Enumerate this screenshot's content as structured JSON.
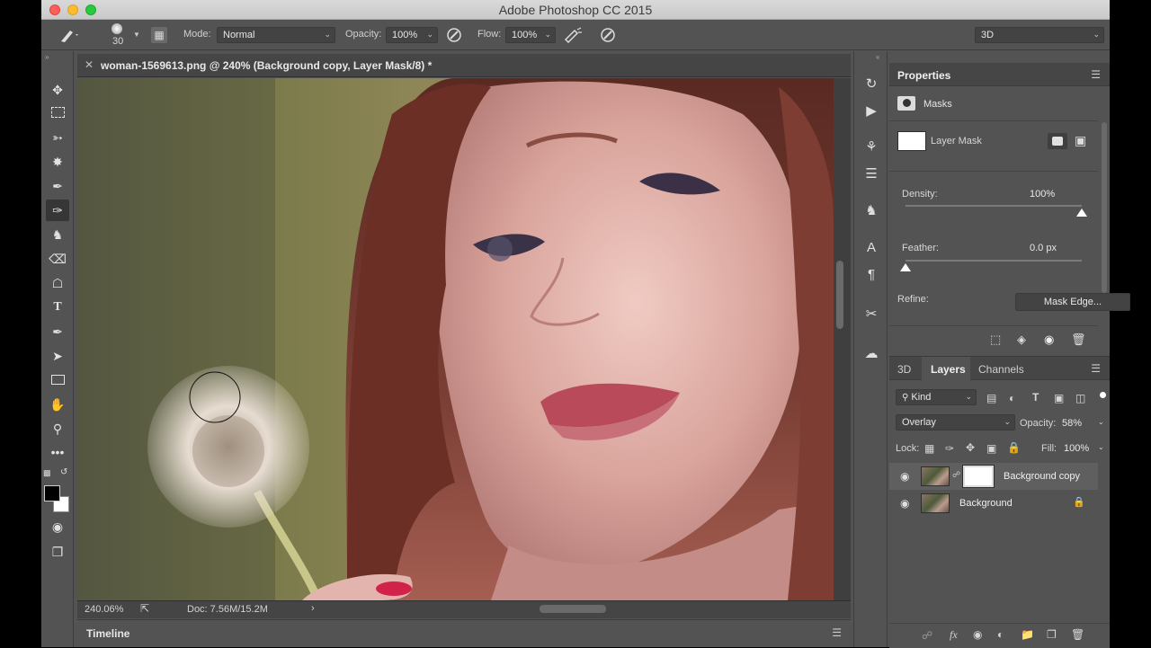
{
  "app": {
    "title": "Adobe Photoshop CC 2015"
  },
  "options_bar": {
    "brush_size": "30",
    "mode_label": "Mode:",
    "mode_value": "Normal",
    "opacity_label": "Opacity:",
    "opacity_value": "100%",
    "flow_label": "Flow:",
    "flow_value": "100%",
    "workspace": "3D"
  },
  "document": {
    "tab_title": "woman-1569613.png @ 240% (Background copy, Layer Mask/8) *",
    "zoom": "240.06%",
    "doc_size": "Doc: 7.56M/15.2M"
  },
  "timeline": {
    "label": "Timeline"
  },
  "properties": {
    "title": "Properties",
    "section": "Masks",
    "mask_label": "Layer Mask",
    "density_label": "Density:",
    "density_value": "100%",
    "density_level": 1.0,
    "feather_label": "Feather:",
    "feather_value": "0.0 px",
    "feather_level": 0.0,
    "refine_label": "Refine:",
    "mask_edge_button": "Mask Edge..."
  },
  "layers_panel": {
    "tabs": [
      "3D",
      "Layers",
      "Channels"
    ],
    "filter_kind": "Kind",
    "blend_mode": "Overlay",
    "opacity_label": "Opacity:",
    "opacity_value": "58%",
    "lock_label": "Lock:",
    "fill_label": "Fill:",
    "fill_value": "100%",
    "layers": [
      {
        "name": "Background copy",
        "selected": true
      },
      {
        "name": "Background",
        "locked": true
      }
    ]
  },
  "colors": {
    "panel_bg": "#535353",
    "dark_bg": "#434343",
    "selected_row": "#5f5f5f",
    "accent_lip": "#b84a5a"
  }
}
